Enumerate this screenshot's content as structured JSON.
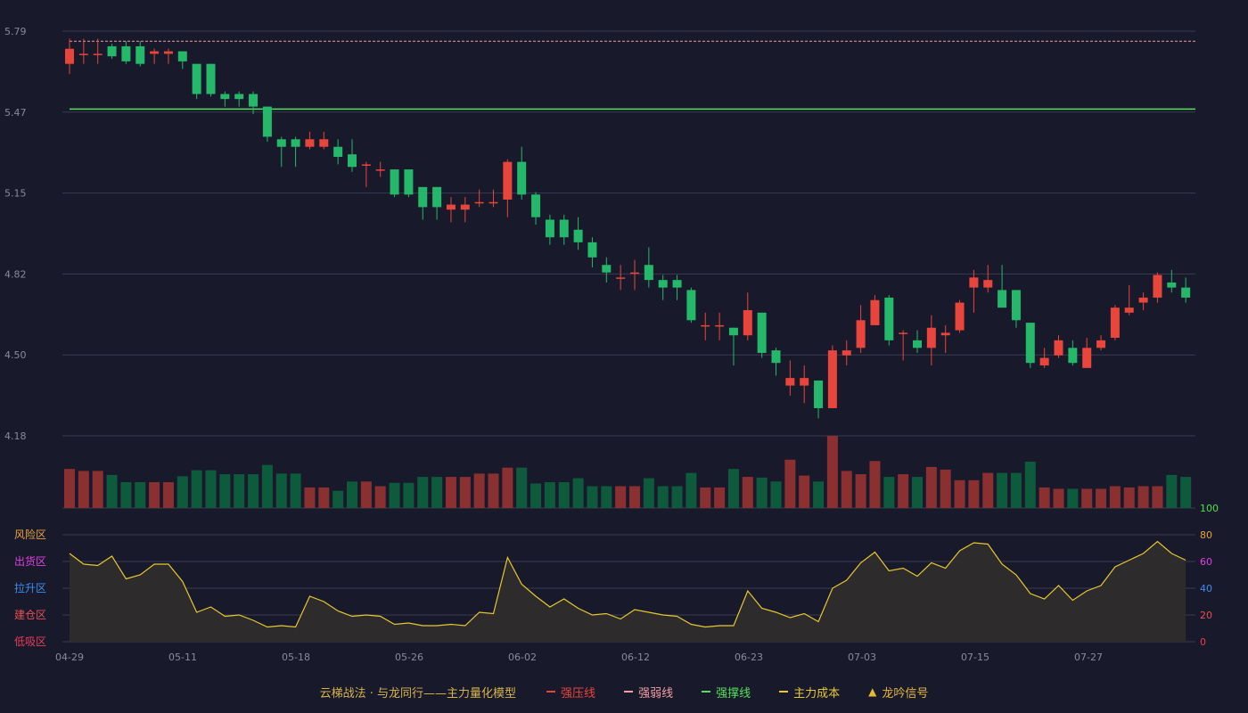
{
  "chart_data": {
    "type": "candlestick",
    "price_axis": {
      "ticks": [
        "5.79",
        "5.47",
        "5.15",
        "4.82",
        "4.50",
        "4.18"
      ],
      "ylim": [
        4.18,
        5.79
      ]
    },
    "x_axis": {
      "tick_labels": [
        "04-29",
        "05-11",
        "05-18",
        "05-26",
        "06-02",
        "06-12",
        "06-23",
        "07-03",
        "07-15",
        "07-27"
      ]
    },
    "reference_lines": [
      {
        "name": "强弱线",
        "value": 5.75,
        "style": "dashed",
        "color": "#f0a0a0"
      },
      {
        "name": "强撑线",
        "value": 5.48,
        "style": "solid",
        "color": "#54e05a"
      }
    ],
    "candles": [
      [
        5.66,
        5.72,
        5.76,
        5.62,
        5.9
      ],
      [
        5.7,
        5.7,
        5.76,
        5.66,
        5.6
      ],
      [
        5.7,
        5.7,
        5.76,
        5.66,
        5.6
      ],
      [
        5.73,
        5.69,
        5.74,
        5.68,
        5.0
      ],
      [
        5.73,
        5.67,
        5.75,
        5.66,
        3.9
      ],
      [
        5.73,
        5.66,
        5.75,
        5.65,
        3.9
      ],
      [
        5.7,
        5.71,
        5.72,
        5.66,
        3.9
      ],
      [
        5.7,
        5.71,
        5.72,
        5.66,
        3.9
      ],
      [
        5.71,
        5.67,
        5.71,
        5.64,
        4.8
      ],
      [
        5.66,
        5.54,
        5.66,
        5.52,
        5.7
      ],
      [
        5.66,
        5.54,
        5.66,
        5.53,
        5.7
      ],
      [
        5.54,
        5.52,
        5.55,
        5.49,
        5.1
      ],
      [
        5.54,
        5.52,
        5.55,
        5.49,
        5.1
      ],
      [
        5.54,
        5.49,
        5.55,
        5.46,
        5.1
      ],
      [
        5.49,
        5.37,
        5.49,
        5.35,
        6.5
      ],
      [
        5.36,
        5.33,
        5.37,
        5.25,
        5.2
      ],
      [
        5.36,
        5.33,
        5.37,
        5.25,
        5.2
      ],
      [
        5.33,
        5.36,
        5.39,
        5.32,
        3.1
      ],
      [
        5.33,
        5.36,
        5.39,
        5.32,
        3.1
      ],
      [
        5.33,
        5.29,
        5.36,
        5.26,
        2.6
      ],
      [
        5.3,
        5.25,
        5.36,
        5.23,
        4.0
      ],
      [
        5.26,
        5.26,
        5.27,
        5.17,
        4.0
      ],
      [
        5.24,
        5.24,
        5.27,
        5.21,
        3.3
      ],
      [
        5.24,
        5.14,
        5.24,
        5.13,
        3.8
      ],
      [
        5.24,
        5.14,
        5.24,
        5.13,
        3.8
      ],
      [
        5.17,
        5.09,
        5.17,
        5.04,
        4.7
      ],
      [
        5.17,
        5.09,
        5.17,
        5.04,
        4.7
      ],
      [
        5.08,
        5.1,
        5.13,
        5.03,
        4.7
      ],
      [
        5.08,
        5.1,
        5.13,
        5.03,
        4.7
      ],
      [
        5.11,
        5.11,
        5.16,
        5.09,
        5.2
      ],
      [
        5.11,
        5.11,
        5.16,
        5.09,
        5.2
      ],
      [
        5.12,
        5.27,
        5.28,
        5.05,
        6.1
      ],
      [
        5.27,
        5.14,
        5.33,
        5.12,
        6.1
      ],
      [
        5.14,
        5.05,
        5.15,
        5.02,
        3.7
      ],
      [
        5.04,
        4.97,
        5.06,
        4.94,
        3.9
      ],
      [
        5.04,
        4.97,
        5.06,
        4.94,
        3.9
      ],
      [
        5.0,
        4.95,
        5.05,
        4.92,
        4.5
      ],
      [
        4.95,
        4.89,
        4.97,
        4.85,
        3.3
      ],
      [
        4.86,
        4.83,
        4.89,
        4.79,
        3.3
      ],
      [
        4.81,
        4.81,
        4.86,
        4.76,
        3.3
      ],
      [
        4.83,
        4.83,
        4.88,
        4.76,
        3.3
      ],
      [
        4.86,
        4.8,
        4.93,
        4.77,
        4.5
      ],
      [
        4.8,
        4.77,
        4.82,
        4.72,
        3.3
      ],
      [
        4.8,
        4.77,
        4.82,
        4.72,
        3.3
      ],
      [
        4.76,
        4.64,
        4.77,
        4.63,
        5.3
      ],
      [
        4.62,
        4.62,
        4.67,
        4.56,
        3.1
      ],
      [
        4.62,
        4.62,
        4.67,
        4.56,
        3.1
      ],
      [
        4.61,
        4.58,
        4.61,
        4.46,
        5.9
      ],
      [
        4.58,
        4.68,
        4.75,
        4.56,
        4.7
      ],
      [
        4.67,
        4.51,
        4.67,
        4.49,
        4.6
      ],
      [
        4.52,
        4.47,
        4.53,
        4.42,
        4.0
      ],
      [
        4.38,
        4.41,
        4.48,
        4.34,
        7.3
      ],
      [
        4.38,
        4.41,
        4.46,
        4.31,
        4.9
      ],
      [
        4.4,
        4.29,
        4.4,
        4.25,
        4.0
      ],
      [
        4.29,
        4.52,
        4.54,
        4.29,
        10.9
      ],
      [
        4.5,
        4.52,
        4.56,
        4.46,
        5.6
      ],
      [
        4.53,
        4.64,
        4.7,
        4.51,
        5.1
      ],
      [
        4.62,
        4.72,
        4.74,
        4.62,
        7.1
      ],
      [
        4.73,
        4.56,
        4.74,
        4.54,
        4.7
      ],
      [
        4.59,
        4.59,
        4.6,
        4.48,
        5.1
      ],
      [
        4.56,
        4.53,
        4.6,
        4.51,
        4.7
      ],
      [
        4.53,
        4.61,
        4.66,
        4.46,
        6.2
      ],
      [
        4.58,
        4.59,
        4.62,
        4.51,
        5.8
      ],
      [
        4.6,
        4.71,
        4.72,
        4.59,
        4.2
      ],
      [
        4.77,
        4.81,
        4.84,
        4.67,
        4.2
      ],
      [
        4.77,
        4.8,
        4.86,
        4.75,
        5.3
      ],
      [
        4.76,
        4.69,
        4.86,
        4.69,
        5.3
      ],
      [
        4.76,
        4.64,
        4.76,
        4.61,
        5.3
      ],
      [
        4.63,
        4.47,
        4.63,
        4.45,
        7.0
      ],
      [
        4.46,
        4.49,
        4.53,
        4.45,
        3.1
      ],
      [
        4.5,
        4.56,
        4.58,
        4.49,
        2.9
      ],
      [
        4.53,
        4.47,
        4.56,
        4.46,
        2.9
      ],
      [
        4.45,
        4.53,
        4.57,
        4.45,
        2.9
      ],
      [
        4.53,
        4.56,
        4.58,
        4.52,
        2.9
      ],
      [
        4.57,
        4.69,
        4.7,
        4.56,
        3.3
      ],
      [
        4.67,
        4.69,
        4.78,
        4.66,
        3.1
      ],
      [
        4.71,
        4.73,
        4.75,
        4.68,
        3.3
      ],
      [
        4.73,
        4.82,
        4.83,
        4.71,
        3.3
      ],
      [
        4.79,
        4.77,
        4.84,
        4.75,
        5.0
      ],
      [
        4.77,
        4.73,
        4.81,
        4.71,
        4.7
      ]
    ],
    "volume_colors": {
      "up": "#8b3030",
      "down": "#0e5a3c"
    },
    "indicator": {
      "axis_ticks": [
        "100",
        "80",
        "60",
        "40",
        "20",
        "0"
      ],
      "zones": [
        "风险区",
        "出货区",
        "拉升区",
        "建仓区",
        "低吸区"
      ],
      "zone_colors": [
        "#e8a33a",
        "#e040e0",
        "#3c8cf0",
        "#e85050",
        "#e83c5a"
      ],
      "tick_colors": [
        "#4de04d",
        "#e8a33a",
        "#e040e0",
        "#3c8cf0",
        "#e85050",
        "#e83c5a"
      ],
      "line_color": "#e6c830",
      "values": [
        66,
        58,
        57,
        64,
        47,
        50,
        58,
        58,
        45,
        22,
        26,
        19,
        20,
        16,
        11,
        12,
        11,
        34,
        30,
        23,
        19,
        20,
        19,
        13,
        14,
        12,
        12,
        13,
        12,
        22,
        21,
        63,
        43,
        34,
        26,
        32,
        25,
        20,
        21,
        17,
        24,
        22,
        20,
        19,
        13,
        11,
        12,
        12,
        38,
        25,
        22,
        18,
        21,
        15,
        40,
        46,
        59,
        67,
        53,
        55,
        49,
        59,
        55,
        68,
        74,
        73,
        58,
        50,
        36,
        32,
        42,
        31,
        38,
        42,
        56,
        61,
        66,
        75,
        66,
        61
      ]
    }
  },
  "legend": {
    "title": "云梯战法 · 与龙同行——主力量化模型",
    "items": [
      {
        "label": "强压线",
        "swatch": "sw-solid-red",
        "color": "#e8453c"
      },
      {
        "label": "强弱线",
        "swatch": "sw-dash-pink",
        "color": "#f0a0a0"
      },
      {
        "label": "强撑线",
        "swatch": "sw-solid-green",
        "color": "#54e05a"
      },
      {
        "label": "主力成本",
        "swatch": "sw-dash-yellow",
        "color": "#e6c830"
      },
      {
        "label": "龙吟信号",
        "swatch": "tri",
        "color": "#e6b83a"
      }
    ]
  },
  "colors": {
    "up": "#e8453c",
    "down": "#25b86a",
    "grid": "#3a3a50",
    "axis_text": "#8a8a99"
  }
}
